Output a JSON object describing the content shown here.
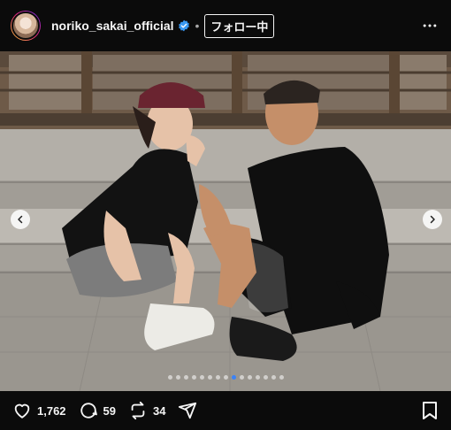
{
  "header": {
    "username": "noriko_sakai_official",
    "separator": "•",
    "follow_label": "フォロー中",
    "verified_color": "#3897f0"
  },
  "post": {
    "carousel_total_dots": 15,
    "carousel_active_index": 8
  },
  "actions": {
    "likes": "1,762",
    "comments": "59",
    "reposts": "34"
  },
  "icons": {
    "more": "more-horizontal-icon",
    "like": "heart-icon",
    "comment": "comment-icon",
    "repost": "repost-icon",
    "share": "send-icon",
    "save": "bookmark-icon",
    "prev": "chevron-left-icon",
    "next": "chevron-right-icon"
  }
}
